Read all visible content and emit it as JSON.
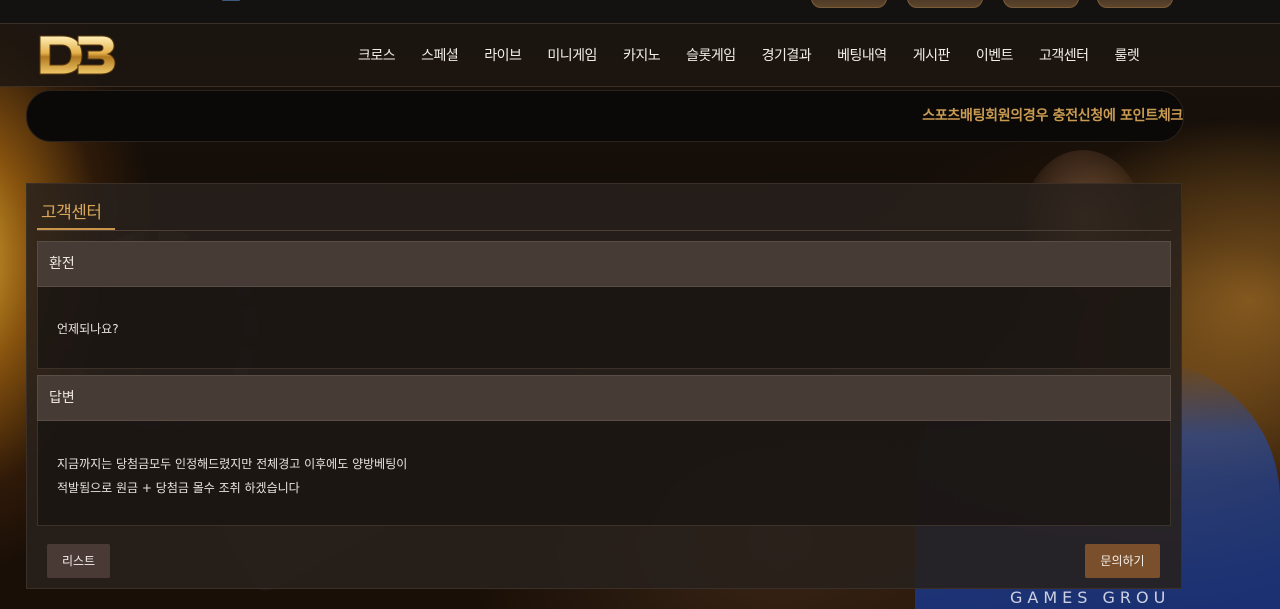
{
  "header": {
    "logo_text": "DB",
    "nav": [
      "크로스",
      "스페셜",
      "라이브",
      "미니게임",
      "카지노",
      "슬롯게임",
      "경기결과",
      "베팅내역",
      "게시판",
      "이벤트",
      "고객센터",
      "룰렛"
    ]
  },
  "ticker": {
    "message": "스포츠배팅회원의경우 충전신청에 포인트체크"
  },
  "panel": {
    "title": "고객센터",
    "question_label": "환전",
    "question_text": "언제되나요?",
    "answer_label": "답변",
    "answer_line1": "지금까지는 당첨금모두 인정해드렸지만 전체경고 이후에도 양방베팅이",
    "answer_line2": "적발됨으로 원금 + 당첨금 몰수 조취 하겠습니다",
    "list_button": "리스트",
    "ask_button": "문의하기"
  },
  "background": {
    "brand_text": "GAMES GROU"
  },
  "colors": {
    "accent_gold": "#c9954a",
    "ticker_text": "#c99a52",
    "section_head": "#463b35",
    "ask_button": "#7a4f2c",
    "list_button": "#4a3a35"
  }
}
